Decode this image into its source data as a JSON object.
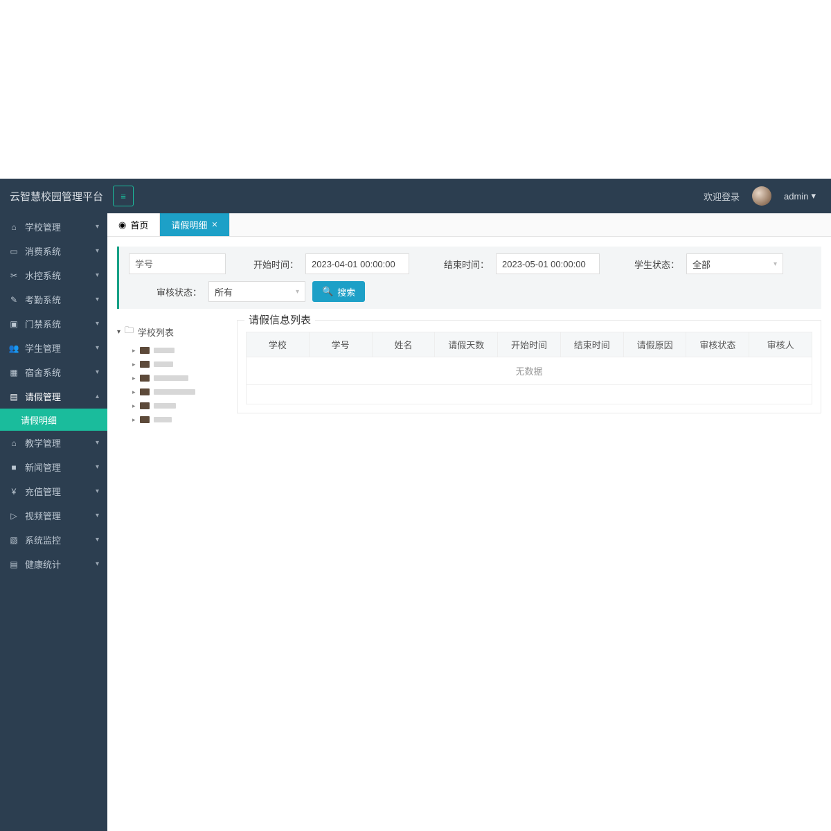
{
  "brand": "云智慧校园管理平台",
  "header": {
    "welcome": "欢迎登录",
    "user": "admin"
  },
  "sidebar": {
    "items": [
      {
        "icon": "⌂",
        "label": "学校管理"
      },
      {
        "icon": "▭",
        "label": "消费系统"
      },
      {
        "icon": "✂",
        "label": "水控系统"
      },
      {
        "icon": "✎",
        "label": "考勤系统"
      },
      {
        "icon": "▣",
        "label": "门禁系统"
      },
      {
        "icon": "👥",
        "label": "学生管理"
      },
      {
        "icon": "▦",
        "label": "宿舍系统"
      },
      {
        "icon": "▤",
        "label": "请假管理",
        "expanded": true
      },
      {
        "icon": "⌂",
        "label": "教学管理"
      },
      {
        "icon": "■",
        "label": "新闻管理"
      },
      {
        "icon": "¥",
        "label": "充值管理"
      },
      {
        "icon": "▷",
        "label": "视频管理"
      },
      {
        "icon": "▧",
        "label": "系统监控"
      },
      {
        "icon": "▤",
        "label": "健康统计"
      }
    ],
    "active_sub": "请假明细"
  },
  "tabs": [
    {
      "icon": "◉",
      "label": "首页"
    },
    {
      "label": "请假明细",
      "active": true,
      "closable": true
    }
  ],
  "filter": {
    "student_id_placeholder": "学号",
    "start_label": "开始时间：",
    "start_value": "2023-04-01 00:00:00",
    "end_label": "结束时间：",
    "end_value": "2023-05-01 00:00:00",
    "student_status_label": "学生状态：",
    "student_status_value": "全部",
    "audit_status_label": "审核状态：",
    "audit_status_value": "所有",
    "search": "搜索"
  },
  "tree": {
    "root": "学校列表",
    "node_count": 6
  },
  "list": {
    "title": "请假信息列表",
    "columns": [
      "学校",
      "学号",
      "姓名",
      "请假天数",
      "开始时间",
      "结束时间",
      "请假原因",
      "审核状态",
      "审核人"
    ],
    "empty": "无数据"
  }
}
